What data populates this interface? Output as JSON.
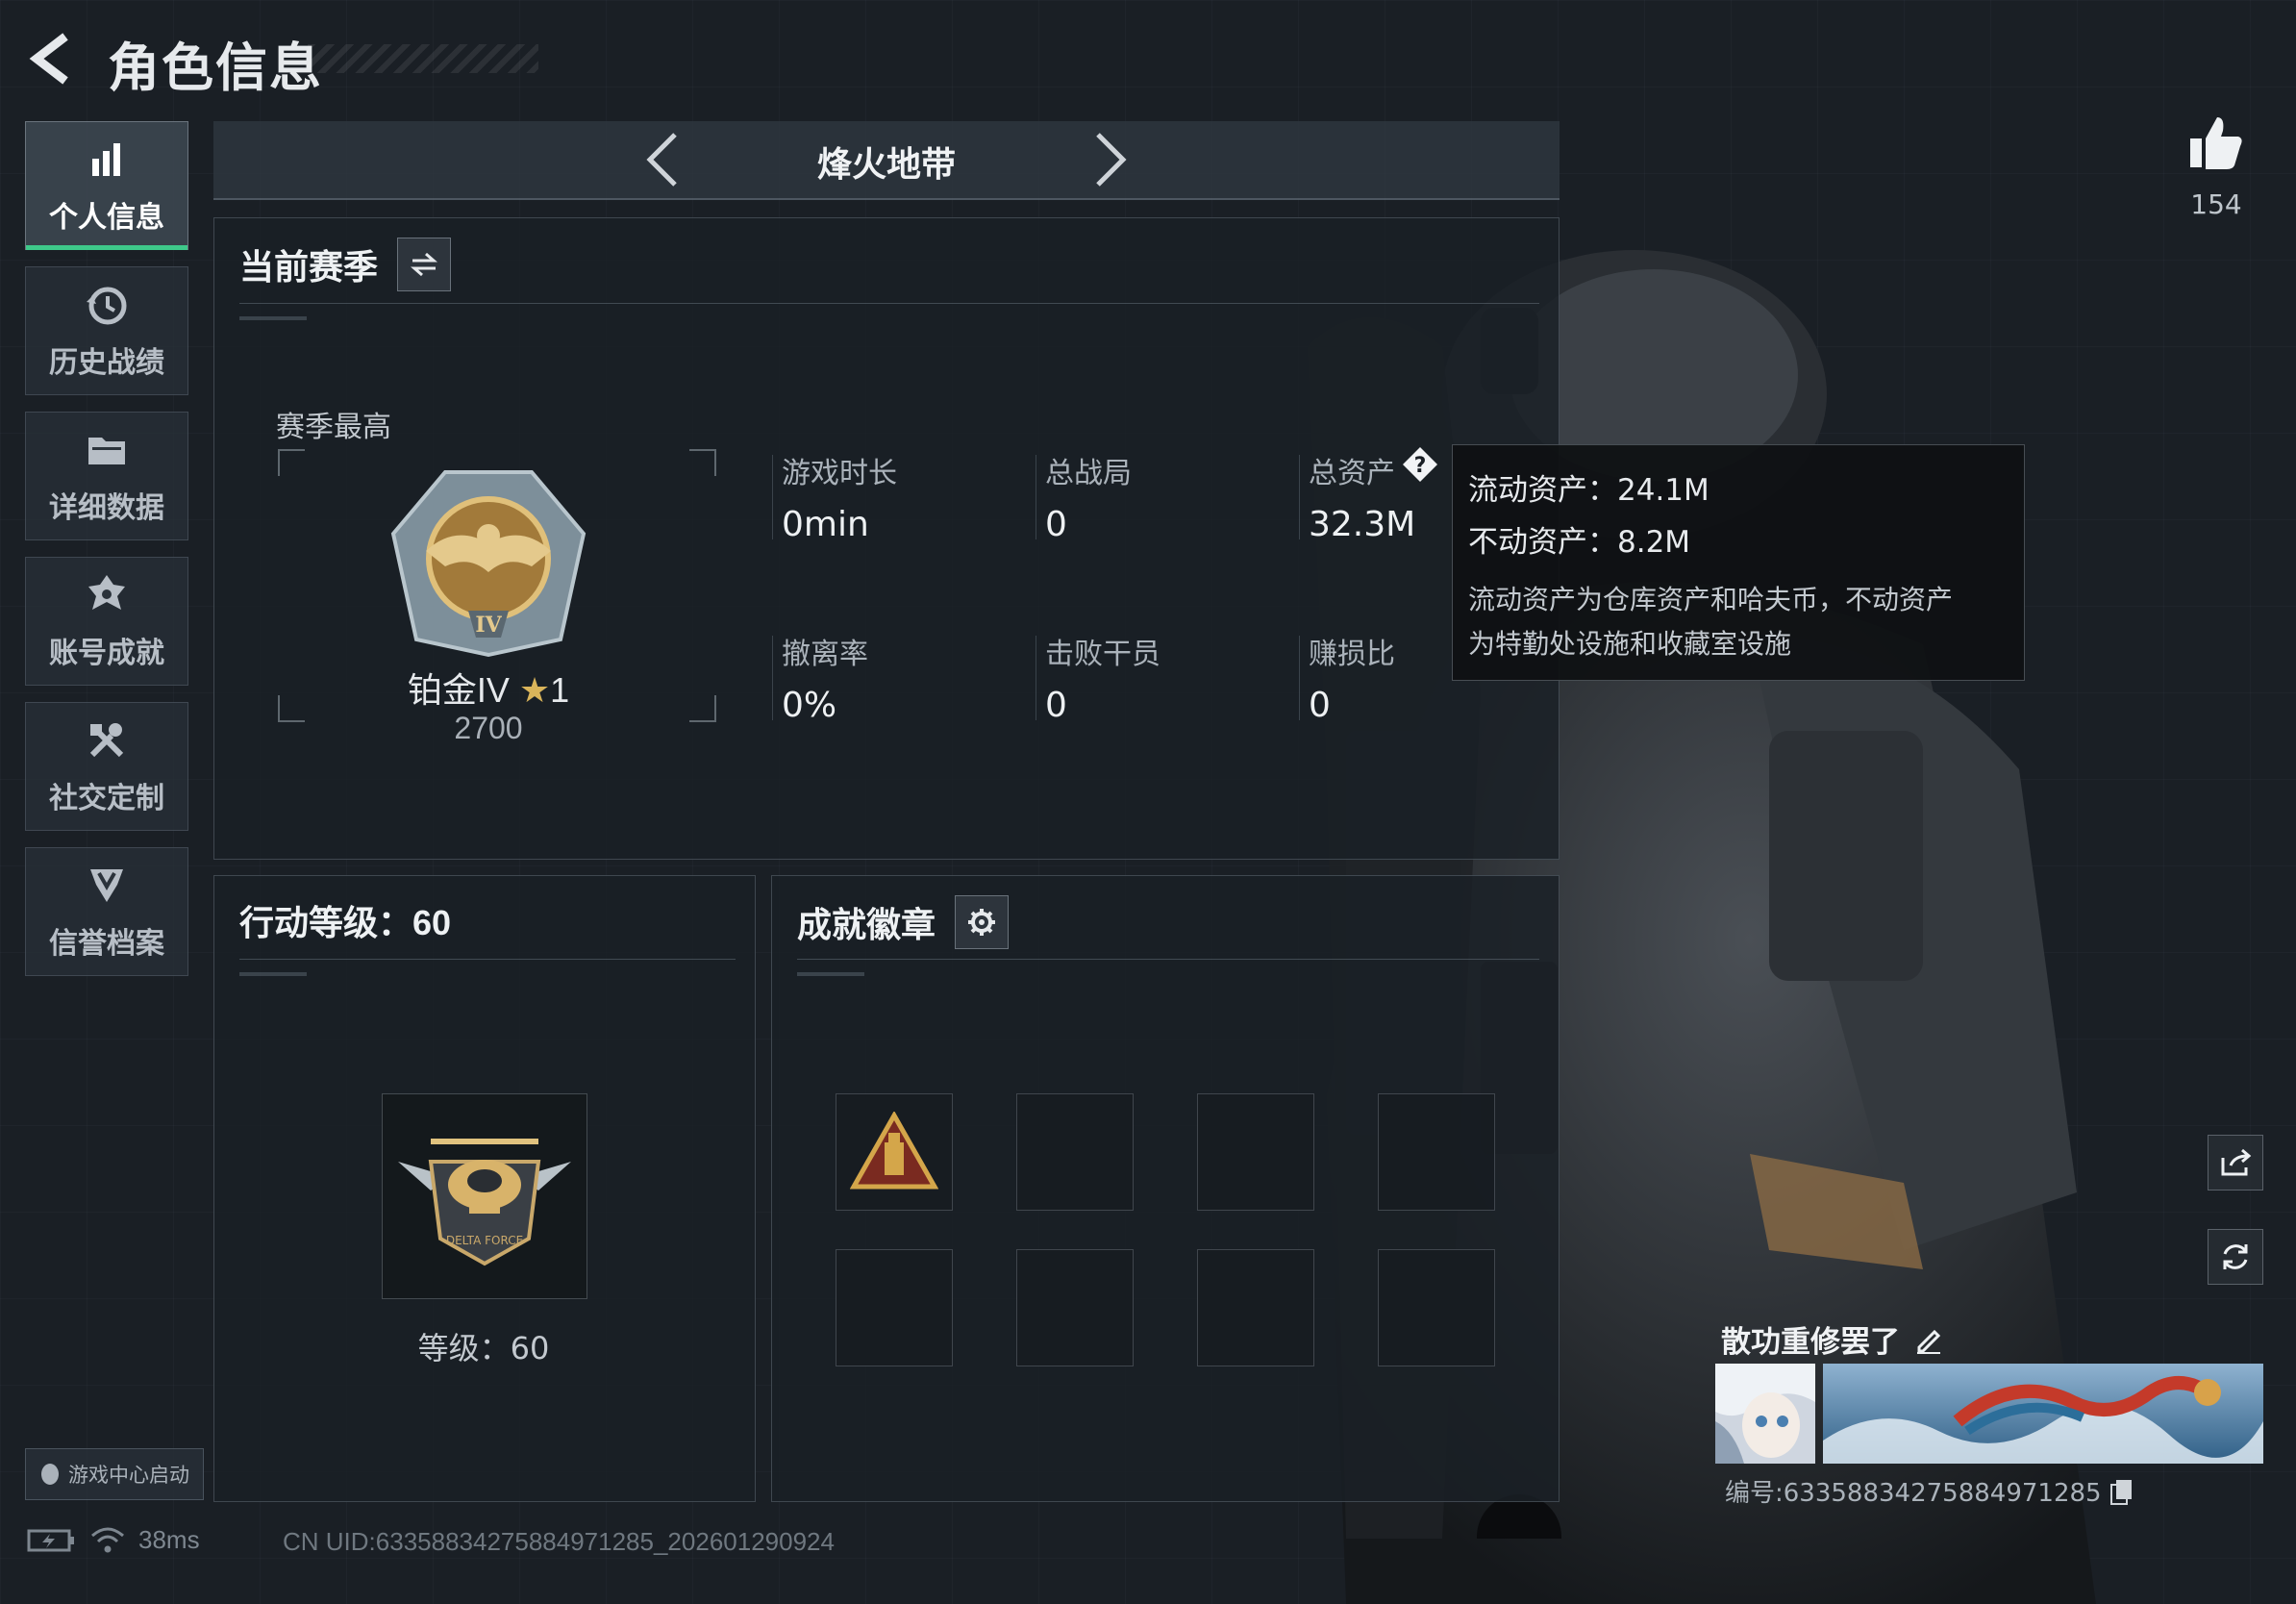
{
  "header": {
    "title": "角色信息"
  },
  "sidebar": {
    "items": [
      {
        "label": "个人信息",
        "active": true
      },
      {
        "label": "历史战绩"
      },
      {
        "label": "详细数据"
      },
      {
        "label": "账号成就"
      },
      {
        "label": "社交定制"
      },
      {
        "label": "信誉档案"
      }
    ],
    "launch_label": "游戏中心启动"
  },
  "mode": {
    "title": "烽火地带"
  },
  "season": {
    "title": "当前赛季",
    "best_label": "赛季最高",
    "rank_name": "铂金IV",
    "rank_stars": "1",
    "rank_points": "2700",
    "stats": [
      {
        "label": "游戏时长",
        "value": "0min"
      },
      {
        "label": "总战局",
        "value": "0"
      },
      {
        "label": "总资产",
        "value": "32.3M"
      },
      {
        "label": "撤离率",
        "value": "0%"
      },
      {
        "label": "击败干员",
        "value": "0"
      },
      {
        "label": "赚损比",
        "value": "0"
      }
    ]
  },
  "tooltip": {
    "liquid": "流动资产：24.1M",
    "fixed": "不动资产：8.2M",
    "desc_1": "流动资产为仓库资产和哈夫币，不动资产",
    "desc_2": "为特勤处设施和收藏室设施"
  },
  "action_level": {
    "title": "行动等级：60",
    "level_text": "等级：60"
  },
  "achievements": {
    "title": "成就徽章"
  },
  "profile": {
    "likes": "154",
    "nickname": "散功重修罢了",
    "uid_code": "编号:6335883427588497128​5"
  },
  "status": {
    "ping": "38ms",
    "uid_line": "CN UID:6335883427588497128​5_202601290924"
  },
  "colors": {
    "accent_green": "#3ec98a",
    "panel_bg": "#1a2026"
  }
}
